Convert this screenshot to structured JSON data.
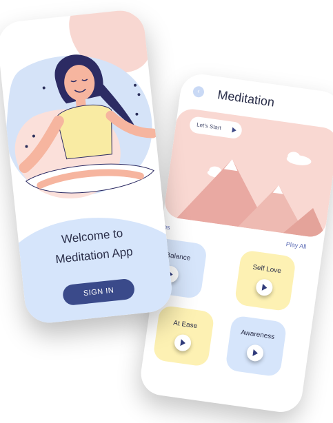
{
  "meditation_screen": {
    "title": "Meditation",
    "back_icon": "chevron-left-icon",
    "hero_button_label": "Let's Start",
    "sessions_label": "ons",
    "play_all_label": "Play All",
    "cards": [
      {
        "label": "Balance",
        "color": "#d6e5fb"
      },
      {
        "label": "Self Love",
        "color": "#fdf1b3"
      },
      {
        "label": "At Ease",
        "color": "#fdf1b3"
      },
      {
        "label": "Awareness",
        "color": "#d6e5fb"
      }
    ]
  },
  "welcome_screen": {
    "welcome_line1": "Welcome to",
    "welcome_line2": "Meditation App",
    "signin_label": "SIGN IN"
  },
  "colors": {
    "primary": "#3a4a8a",
    "pink": "#f9d8d2",
    "blue": "#d6e5fb",
    "yellow": "#fdf1b3",
    "text": "#2b2f4a"
  }
}
